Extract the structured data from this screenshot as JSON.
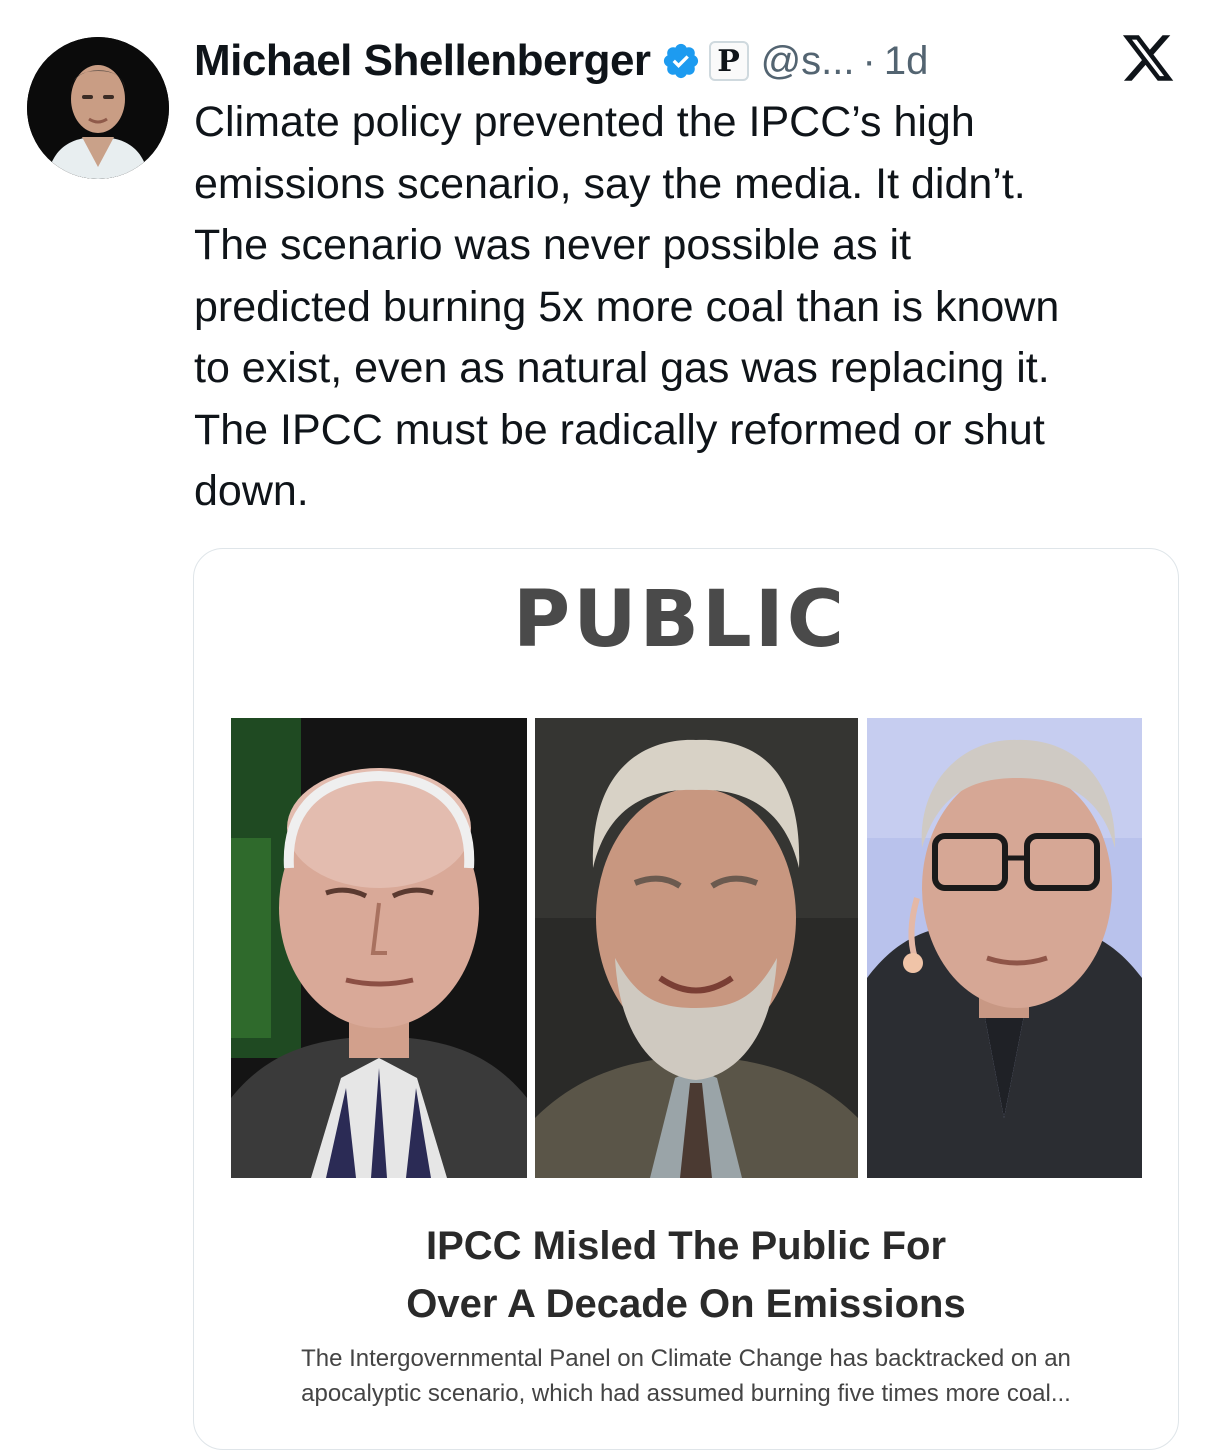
{
  "author": {
    "name": "Michael Shellenberger",
    "handle": "@s...",
    "separator": "·",
    "time": "1d",
    "affiliation_badge": "P",
    "verified_color": "#1d9bf0"
  },
  "tweet": {
    "text": "Climate policy prevented the IPCC’s high\nemissions scenario, say the media. It didn’t.\nThe scenario was never possible as it\npredicted burning 5x more coal than is known\nto exist, even as natural gas was replacing it.\nThe IPCC must be radically reformed or shut\ndown."
  },
  "card": {
    "publication": "PUBLIC",
    "headline": "IPCC Misled The Public For\nOver A Decade On Emissions",
    "summary": "The Intergovernmental Panel on Climate Change has backtracked on an\napocalyptic scenario, which had assumed burning five times more coal..."
  },
  "icons": {
    "verified": "verified-badge-icon",
    "brand": "x-logo-icon"
  },
  "colors": {
    "text_primary": "#0f1419",
    "text_secondary": "#536471",
    "card_border": "#dfe5e9"
  }
}
